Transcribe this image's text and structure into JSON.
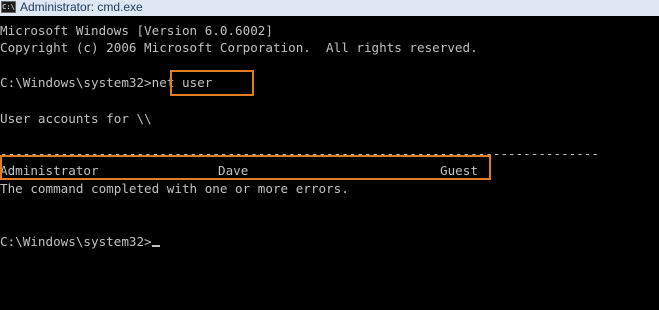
{
  "window": {
    "title": "Administrator: cmd.exe",
    "icon_label": "C:\\"
  },
  "console": {
    "banner_line1": "Microsoft Windows [Version 6.0.6002]",
    "banner_line2": "Copyright (c) 2006 Microsoft Corporation.  All rights reserved.",
    "prompt1": "C:\\Windows\\system32>",
    "command1": "net user",
    "accounts_header": "User accounts for \\\\",
    "separator": "-------------------------------------------------------------------------------",
    "users": [
      "Administrator",
      "Dave",
      "Guest"
    ],
    "result_message": "The command completed with one or more errors.",
    "prompt2": "C:\\Windows\\system32>"
  },
  "colors": {
    "console_background": "#000000",
    "console_text": "#c0c0c0",
    "highlight_box": "#e07c22",
    "titlebar_background": "#dde8f4"
  }
}
